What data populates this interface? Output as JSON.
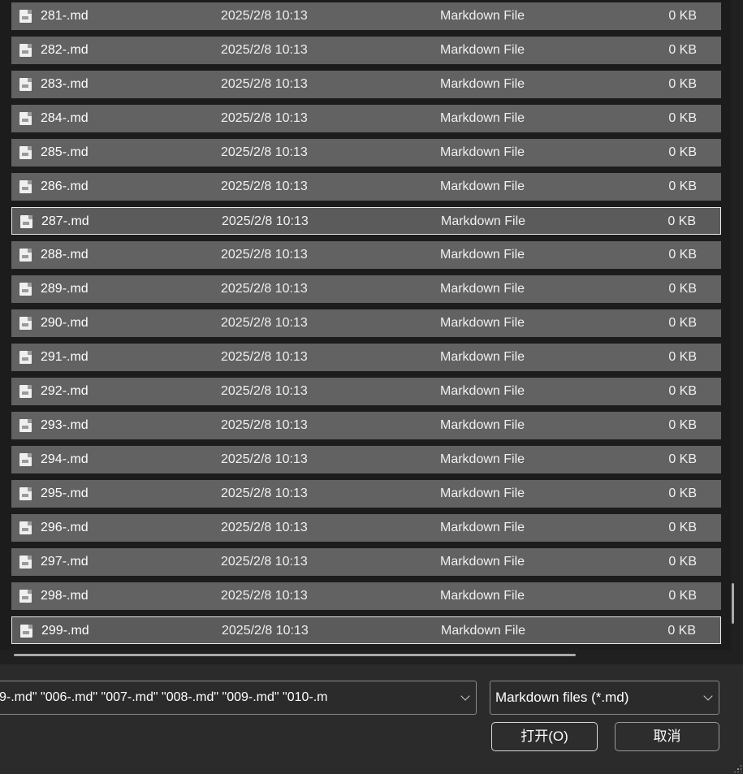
{
  "files": [
    {
      "name": "281-.md",
      "date": "2025/2/8 10:13",
      "type": "Markdown File",
      "size": "0 KB",
      "icon": "markdown-file-icon"
    },
    {
      "name": "282-.md",
      "date": "2025/2/8 10:13",
      "type": "Markdown File",
      "size": "0 KB",
      "icon": "markdown-file-icon"
    },
    {
      "name": "283-.md",
      "date": "2025/2/8 10:13",
      "type": "Markdown File",
      "size": "0 KB",
      "icon": "markdown-file-icon"
    },
    {
      "name": "284-.md",
      "date": "2025/2/8 10:13",
      "type": "Markdown File",
      "size": "0 KB",
      "icon": "markdown-file-icon"
    },
    {
      "name": "285-.md",
      "date": "2025/2/8 10:13",
      "type": "Markdown File",
      "size": "0 KB",
      "icon": "markdown-file-icon"
    },
    {
      "name": "286-.md",
      "date": "2025/2/8 10:13",
      "type": "Markdown File",
      "size": "0 KB",
      "icon": "markdown-file-icon"
    },
    {
      "name": "287-.md",
      "date": "2025/2/8 10:13",
      "type": "Markdown File",
      "size": "0 KB",
      "icon": "markdown-file-icon",
      "focused": true
    },
    {
      "name": "288-.md",
      "date": "2025/2/8 10:13",
      "type": "Markdown File",
      "size": "0 KB",
      "icon": "markdown-file-icon"
    },
    {
      "name": "289-.md",
      "date": "2025/2/8 10:13",
      "type": "Markdown File",
      "size": "0 KB",
      "icon": "markdown-file-icon"
    },
    {
      "name": "290-.md",
      "date": "2025/2/8 10:13",
      "type": "Markdown File",
      "size": "0 KB",
      "icon": "markdown-file-icon"
    },
    {
      "name": "291-.md",
      "date": "2025/2/8 10:13",
      "type": "Markdown File",
      "size": "0 KB",
      "icon": "markdown-file-icon"
    },
    {
      "name": "292-.md",
      "date": "2025/2/8 10:13",
      "type": "Markdown File",
      "size": "0 KB",
      "icon": "markdown-file-icon"
    },
    {
      "name": "293-.md",
      "date": "2025/2/8 10:13",
      "type": "Markdown File",
      "size": "0 KB",
      "icon": "markdown-file-icon"
    },
    {
      "name": "294-.md",
      "date": "2025/2/8 10:13",
      "type": "Markdown File",
      "size": "0 KB",
      "icon": "markdown-file-icon"
    },
    {
      "name": "295-.md",
      "date": "2025/2/8 10:13",
      "type": "Markdown File",
      "size": "0 KB",
      "icon": "markdown-file-icon"
    },
    {
      "name": "296-.md",
      "date": "2025/2/8 10:13",
      "type": "Markdown File",
      "size": "0 KB",
      "icon": "markdown-file-icon"
    },
    {
      "name": "297-.md",
      "date": "2025/2/8 10:13",
      "type": "Markdown File",
      "size": "0 KB",
      "icon": "markdown-file-icon"
    },
    {
      "name": "298-.md",
      "date": "2025/2/8 10:13",
      "type": "Markdown File",
      "size": "0 KB",
      "icon": "markdown-file-icon"
    },
    {
      "name": "299-.md",
      "date": "2025/2/8 10:13",
      "type": "Markdown File",
      "size": "0 KB",
      "icon": "markdown-file-icon",
      "focused": true
    }
  ],
  "selection": {
    "all_selected": true
  },
  "footer": {
    "filename_value": "9-.md\" \"006-.md\" \"007-.md\" \"008-.md\" \"009-.md\" \"010-.m",
    "filetype_value": "Markdown files (*.md)",
    "open_label": "打开(O)",
    "cancel_label": "取消"
  },
  "colors": {
    "row_selected": "#626262",
    "background": "#202020",
    "focus_border": "#e8e8e8"
  }
}
